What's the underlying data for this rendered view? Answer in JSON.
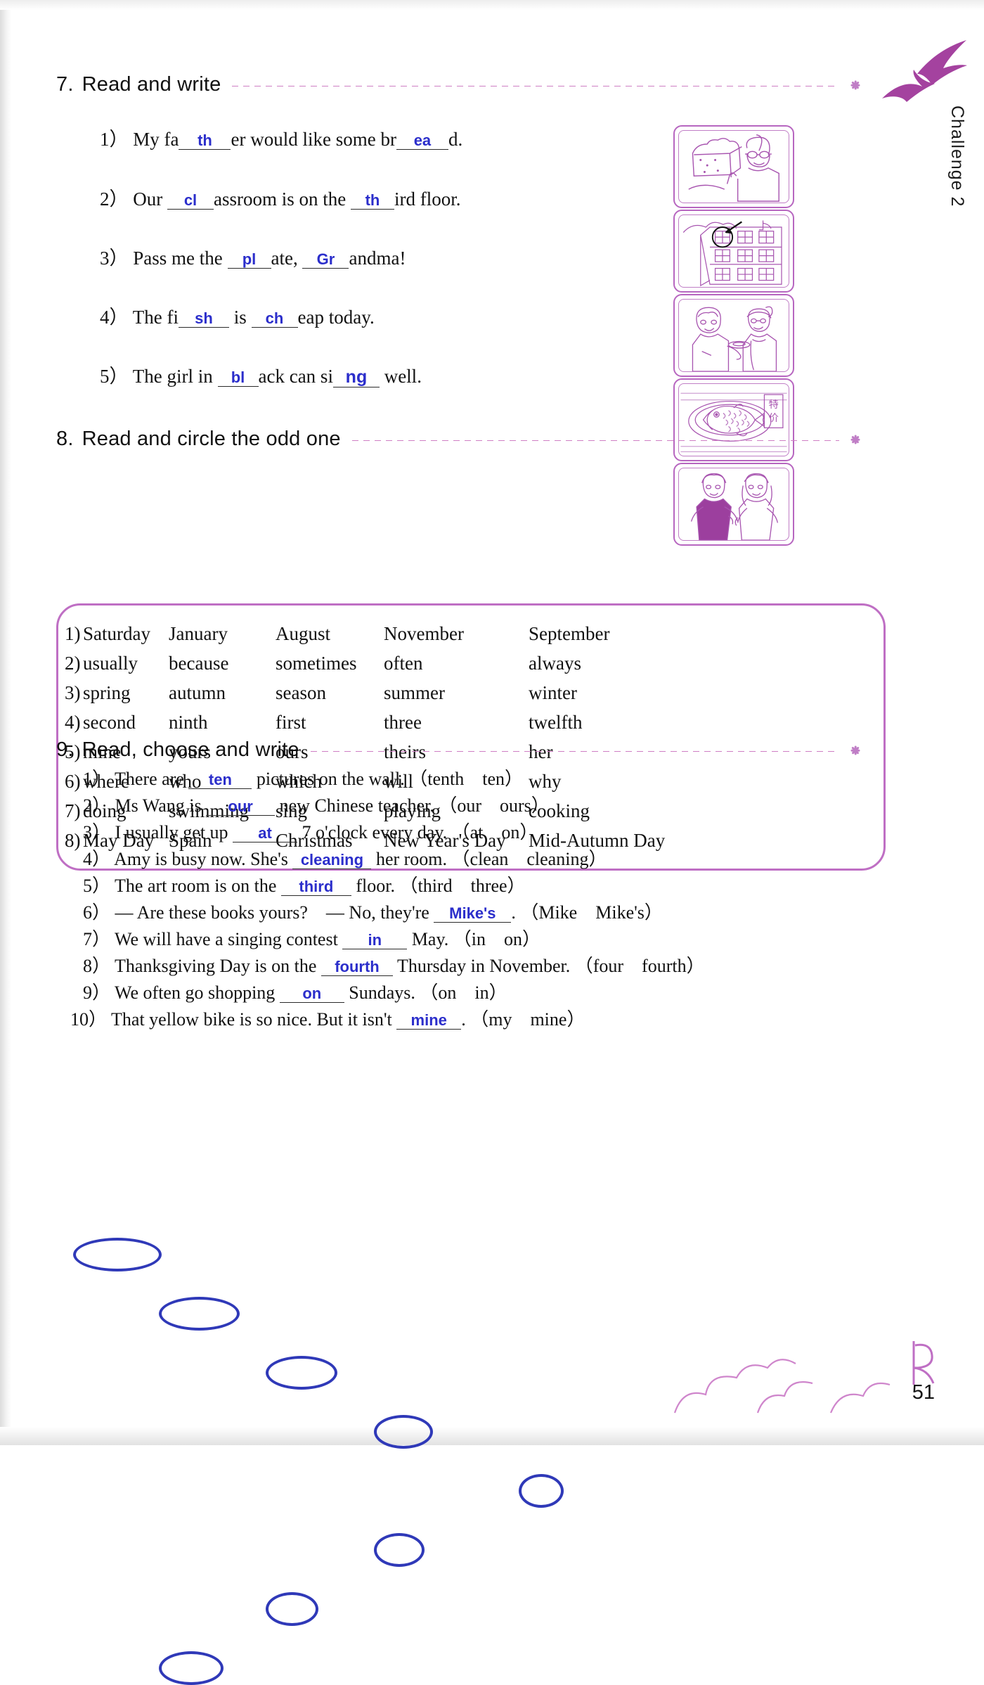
{
  "side_label": "Challenge 2",
  "page_number": "51",
  "sections": [
    {
      "number": "7.",
      "title": "Read and write",
      "items": [
        {
          "n": "1）",
          "pre": "My fa",
          "ans1": "th",
          "mid": "er would like some br",
          "ans2": "ea",
          "post": "d."
        },
        {
          "n": "2）",
          "pre": "Our",
          "ans1": "cl",
          "mid": "assroom is on the",
          "ans2": "th",
          "post": "ird floor."
        },
        {
          "n": "3）",
          "pre": "Pass me the",
          "ans1": "pl",
          "mid": "ate,",
          "ans2": "Gr",
          "post": "andma!"
        },
        {
          "n": "4）",
          "pre": "The fi",
          "ans1": "sh",
          "mid": "is",
          "ans2": "ch",
          "post": "eap today."
        },
        {
          "n": "5）",
          "pre": "The girl in",
          "ans1": "bl",
          "mid": "ack can si",
          "ans2": "ng",
          "post": "well."
        }
      ],
      "pictures": [
        {
          "name": "bread-boy-picture",
          "alt": "boy holding a loaf of bread"
        },
        {
          "name": "building-third-floor-picture",
          "alt": "apartment building with circled third floor window"
        },
        {
          "name": "grandma-plate-picture",
          "alt": "boy and grandma passing a plate"
        },
        {
          "name": "fish-sale-picture",
          "alt": "fish on a plate with a sale sign"
        },
        {
          "name": "girls-singing-picture",
          "alt": "two girls, one in black"
        }
      ]
    },
    {
      "number": "8.",
      "title": "Read and circle the odd one",
      "rows": [
        {
          "n": "1)",
          "words": [
            "Saturday",
            "January",
            "August",
            "November",
            "September"
          ],
          "circled": 0
        },
        {
          "n": "2)",
          "words": [
            "usually",
            "because",
            "sometimes",
            "often",
            "always"
          ],
          "circled": 1
        },
        {
          "n": "3)",
          "words": [
            "spring",
            "autumn",
            "season",
            "summer",
            "winter"
          ],
          "circled": 2
        },
        {
          "n": "4)",
          "words": [
            "second",
            "ninth",
            "first",
            "three",
            "twelfth"
          ],
          "circled": 3
        },
        {
          "n": "5)",
          "words": [
            "mine",
            "yours",
            "ours",
            "theirs",
            "her"
          ],
          "circled": 4
        },
        {
          "n": "6)",
          "words": [
            "where",
            "who",
            "which",
            "will",
            "why"
          ],
          "circled": 3
        },
        {
          "n": "7)",
          "words": [
            "doing",
            "swimming",
            "sing",
            "playing",
            "cooking"
          ],
          "circled": 2
        },
        {
          "n": "8)",
          "words": [
            "May Day",
            "Spain",
            "Christmas",
            "New Year's Day",
            "Mid-Autumn Day"
          ],
          "circled": 1
        }
      ]
    },
    {
      "number": "9.",
      "title": "Read, choose and write",
      "items": [
        {
          "n": "1）",
          "pre": "There are",
          "ans": "ten",
          "post": "pictures on the wall.",
          "opts": "（tenth　ten）"
        },
        {
          "n": "2）",
          "pre": "Ms Wang is",
          "ans": "our",
          "post": "new Chinese teacher.",
          "opts": "（our　ours）"
        },
        {
          "n": "3）",
          "pre": "I usually get up",
          "ans": "at",
          "post": "7 o'clock every day.",
          "opts": "（at　on）"
        },
        {
          "n": "4）",
          "pre": "Amy is busy now. She's",
          "ans": "cleaning",
          "post": "her room.",
          "opts": "（clean　cleaning）"
        },
        {
          "n": "5）",
          "pre": "The art room is on the",
          "ans": "third",
          "post": "floor.",
          "opts": "（third　three）"
        },
        {
          "n": "6）",
          "pre": "— Are these books yours?　— No, they're",
          "ans": "Mike's",
          "post": ".",
          "opts": "（Mike　Mike's）"
        },
        {
          "n": "7）",
          "pre": "We will have a singing contest",
          "ans": "in",
          "post": "May.",
          "opts": "（in　on）"
        },
        {
          "n": "8）",
          "pre": "Thanksgiving Day is on the",
          "ans": "fourth",
          "post": "Thursday in November.",
          "opts": "（four　fourth）"
        },
        {
          "n": "9）",
          "pre": "We often go shopping",
          "ans": "on",
          "post": "Sundays.",
          "opts": "（on　in）"
        },
        {
          "n": "10）",
          "pre": "That yellow bike is so nice. But it isn't",
          "ans": "mine",
          "post": ".",
          "opts": "（my　mine）"
        }
      ]
    }
  ],
  "colors": {
    "accent_purple": "#bf6fc4",
    "answer_blue": "#2b2ecb",
    "circle_blue": "#2f39b8"
  },
  "decorations": {
    "birds": "flying-birds",
    "cloud": "cloud-swirl",
    "logo_letter": "R"
  }
}
